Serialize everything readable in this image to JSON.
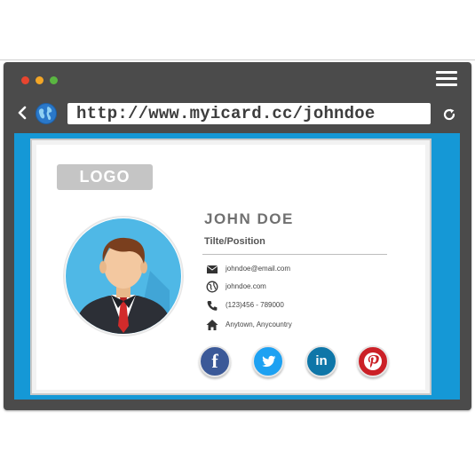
{
  "browser": {
    "url": "http://www.myicard.cc/johndoe",
    "traffic_light_colors": [
      "#e8452f",
      "#f3a626",
      "#5ab641"
    ],
    "icons": [
      "chevron-left-icon",
      "globe-icon",
      "refresh-icon",
      "hamburger-menu-icon"
    ]
  },
  "card": {
    "logo": "LOGO",
    "name": "JOHN DOE",
    "position": "Tilte/Position",
    "contacts": [
      {
        "icon": "email-icon",
        "text": "johndoe@email.com"
      },
      {
        "icon": "globe-icon",
        "text": "johndoe.com"
      },
      {
        "icon": "phone-icon",
        "text": "(123)456 - 789000"
      },
      {
        "icon": "home-icon",
        "text": "Anytown, Anycountry"
      }
    ],
    "social": [
      {
        "name": "facebook",
        "glyph": "f",
        "color": "#3b5998"
      },
      {
        "name": "twitter",
        "glyph": "twitter-bird",
        "color": "#1da1f2"
      },
      {
        "name": "linkedin",
        "glyph": "in",
        "color": "#0e76a8"
      },
      {
        "name": "pinterest",
        "glyph": "P",
        "color": "#cb2027"
      }
    ]
  },
  "colors": {
    "frame": "#4b4b4b",
    "viewport_accent": "#1598d6",
    "avatar_background": "#4fb8e6"
  }
}
